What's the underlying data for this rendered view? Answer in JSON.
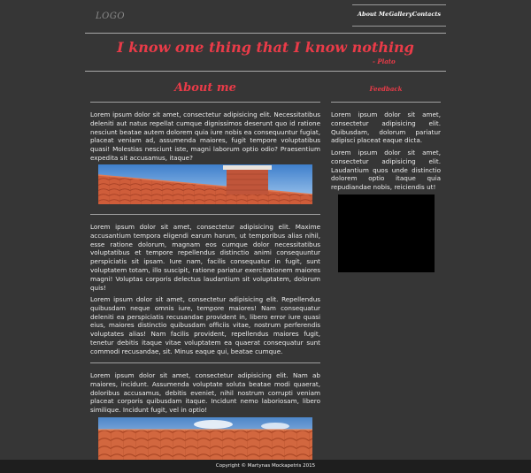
{
  "header": {
    "logo": "LOGO",
    "nav": [
      "About Me",
      "Gallery",
      "Contacts"
    ]
  },
  "hero": {
    "quote": "I know one thing that I know nothing",
    "author": "- Plato"
  },
  "about": {
    "title": "About me",
    "paragraphs": [
      "Lorem ipsum dolor sit amet, consectetur adipisicing elit. Necessitatibus deleniti aut natus repellat cumque dignissimos deserunt quo id ratione nesciunt beatae autem dolorem quia iure nobis ea consequuntur fugiat, placeat veniam ad, assumenda maiores, fugit tempore voluptatibus quasi! Molestias nesciunt iste, magni laborum optio odio? Praesentium expedita sit accusamus, itaque?",
      "Lorem ipsum dolor sit amet, consectetur adipisicing elit. Maxime accusantium tempora eligendi earum harum, ut temporibus alias nihil, esse ratione dolorum, magnam eos cumque dolor necessitatibus voluptatibus et tempore repellendus distinctio animi consequuntur perspiciatis sit ipsam. Iure nam, facilis consequatur in fugit, sunt voluptatem totam, illo suscipit, ratione pariatur exercitationem maiores magni! Voluptas corporis delectus laudantium sit voluptatem, dolorum quis!",
      "Lorem ipsum dolor sit amet, consectetur adipisicing elit. Repellendus quibusdam neque omnis iure, tempore maiores! Nam consequatur deleniti ea perspiciatis recusandae provident in, libero error iure quasi eius, maiores distinctio quibusdam officiis vitae, nostrum perferendis voluptates alias! Nam facilis provident, repellendus maiores fugit, tenetur debitis itaque vitae voluptatem ea quaerat consequatur sunt commodi recusandae, sit. Minus eaque qui, beatae cumque.",
      "Lorem ipsum dolor sit amet, consectetur adipisicing elit. Nam ab maiores, incidunt. Assumenda voluptate soluta beatae modi quaerat, doloribus accusamus, debitis eveniet, nihil nostrum corrupti veniam placeat corporis quibusdam itaque. Incidunt nemo laboriosam, libero similique. Incidunt fugit, vel in optio!"
    ]
  },
  "feedback": {
    "title": "Feedback",
    "paragraphs": [
      "Lorem ipsum dolor sit amet, consectetur adipisicing elit. Quibusdam, dolorum pariatur adipisci placeat eaque dicta.",
      "Lorem ipsum dolor sit amet, consectetur adipisicing elit. Laudantium quos unde distinctio dolorem optio itaque quia repudiandae nobis, reiciendis ut!"
    ]
  },
  "footer": {
    "copyright": "Copyright © Martynas Mockapetris 2015"
  },
  "colors": {
    "background": "#363636",
    "accent": "#ea3b48",
    "footer": "#1e1e1e",
    "tile": "#d2613f",
    "sky": "#4f8fd6"
  }
}
